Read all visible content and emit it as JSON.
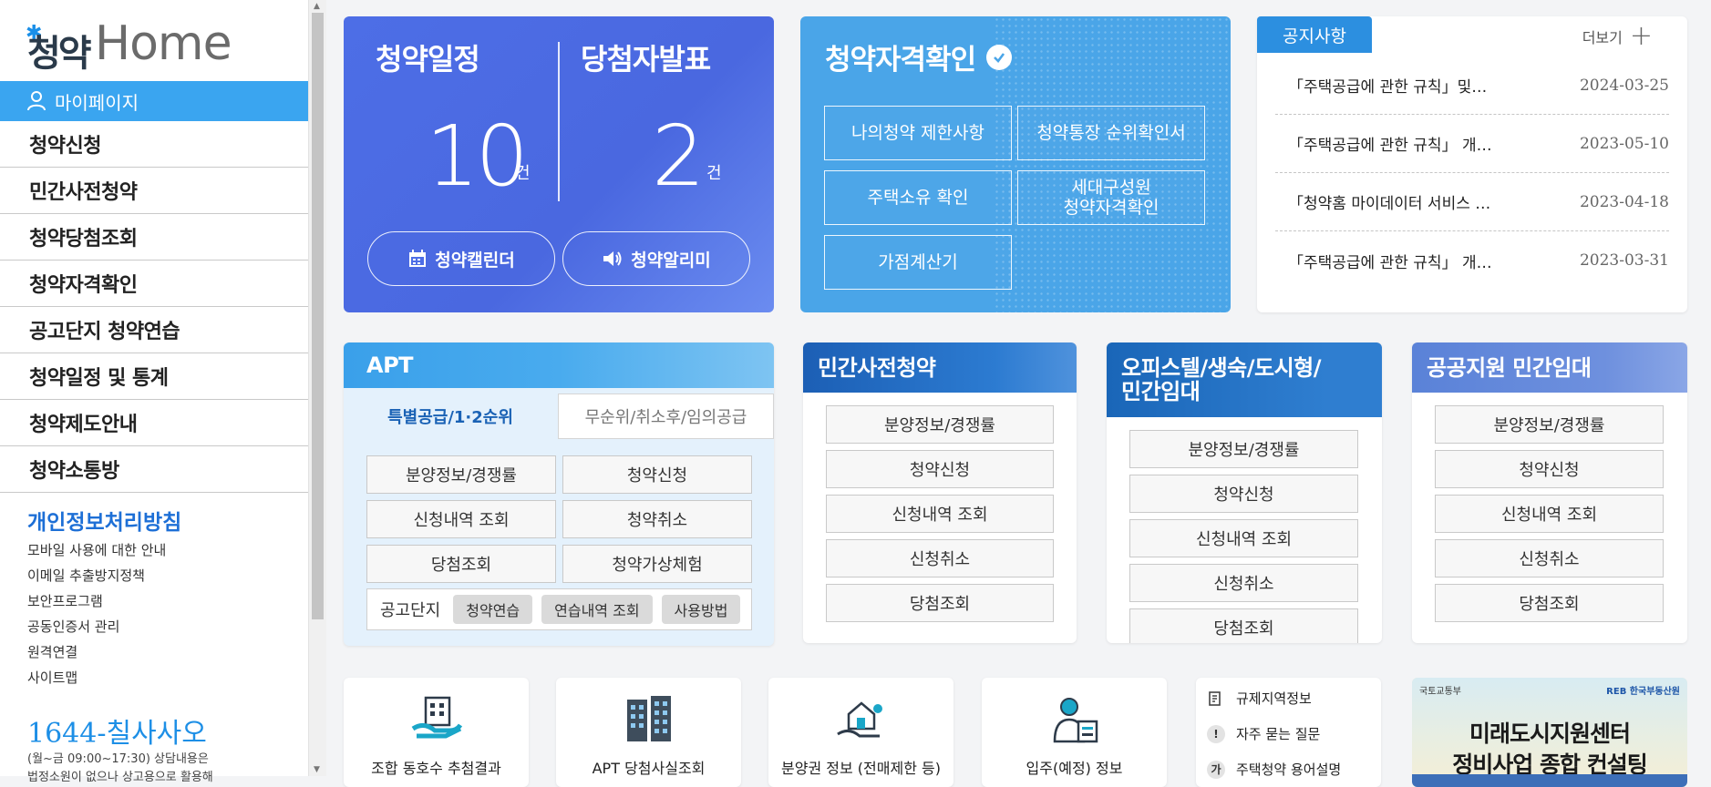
{
  "sidebar": {
    "logo_korean": "청약",
    "logo_english": "Home",
    "mypage_label": "마이페이지",
    "menu": [
      "청약신청",
      "민간사전청약",
      "청약당첨조회",
      "청약자격확인",
      "공고단지 청약연습",
      "청약일정 및 통계",
      "청약제도안내",
      "청약소통방"
    ],
    "privacy_title": "개인정보처리방침",
    "links": [
      "모바일 사용에 대한 안내",
      "이메일 추출방지정책",
      "보안프로그램",
      "공동인증서 관리",
      "원격연결",
      "사이트맵"
    ],
    "phone": "1644-칠사사오",
    "hours_line1": "(월~금 09:00~17:30) 상담내용은",
    "hours_line2": "법정소원이 없으나 상고용으로 활용해"
  },
  "schedule": {
    "left_title": "청약일정",
    "left_count": "10",
    "right_title": "당첨자발표",
    "right_count": "2",
    "unit": "건",
    "calendar_btn": "청약캘린더",
    "alarm_btn": "청약알리미"
  },
  "qualify": {
    "title": "청약자격확인",
    "buttons": [
      "나의청약 제한사항",
      "청약통장 순위확인서",
      "주택소유 확인",
      "세대구성원\n청약자격확인",
      "가점계산기"
    ]
  },
  "notice": {
    "tab_label": "공지사항",
    "more_label": "더보기",
    "items": [
      {
        "title": "「주택공급에 관한 규칙」및…",
        "date": "2024-03-25"
      },
      {
        "title": "「주택공급에 관한 규칙」 개…",
        "date": "2023-05-10"
      },
      {
        "title": "「청약홈 마이데이터 서비스 …",
        "date": "2023-04-18"
      },
      {
        "title": "「주택공급에 관한 규칙」 개…",
        "date": "2023-03-31"
      }
    ]
  },
  "apt": {
    "title": "APT",
    "tab_active": "특별공급/1·2순위",
    "tab_inactive": "무순위/취소후/임의공급",
    "buttons": [
      "분양정보/경쟁률",
      "청약신청",
      "신청내역 조회",
      "청약취소",
      "당첨조회",
      "청약가상체험"
    ],
    "practice_label": "공고단지",
    "practice_pills": [
      "청약연습",
      "연습내역 조회",
      "사용방법"
    ]
  },
  "private_pre": {
    "title": "민간사전청약",
    "buttons": [
      "분양정보/경쟁률",
      "청약신청",
      "신청내역 조회",
      "신청취소",
      "당첨조회"
    ]
  },
  "officetel": {
    "title_line1": "오피스텔/생숙/도시형/",
    "title_line2": "민간임대",
    "buttons": [
      "분양정보/경쟁률",
      "청약신청",
      "신청내역 조회",
      "신청취소",
      "당첨조회"
    ]
  },
  "public_rental": {
    "title": "공공지원 민간임대",
    "buttons": [
      "분양정보/경쟁률",
      "청약신청",
      "신청내역 조회",
      "신청취소",
      "당첨조회"
    ]
  },
  "bottom": {
    "cards": [
      "조합 동호수 추첨결과",
      "APT 당첨사실조회",
      "분양권 정보 (전매제한 등)",
      "입주(예정) 정보"
    ],
    "quick_links": [
      {
        "icon": "regulation-icon",
        "label": "규제지역정보"
      },
      {
        "icon": "faq-icon",
        "label": "자주 묻는 질문"
      },
      {
        "icon": "glossary-icon",
        "label": "주택청약 용어설명"
      }
    ],
    "banner_org_left": "국토교통부",
    "banner_org_right": "REB 한국부동산원",
    "banner_line1": "미래도시지원센터",
    "banner_line2": "정비사업 종합 컨설팅"
  },
  "colors": {
    "accent": "#3aa5f0",
    "schedule_bg": "#4d6ee6",
    "qualify_bg": "#4aa5e8",
    "notice_tab": "#2c8fe0",
    "privacy_link": "#1d6fd6"
  }
}
